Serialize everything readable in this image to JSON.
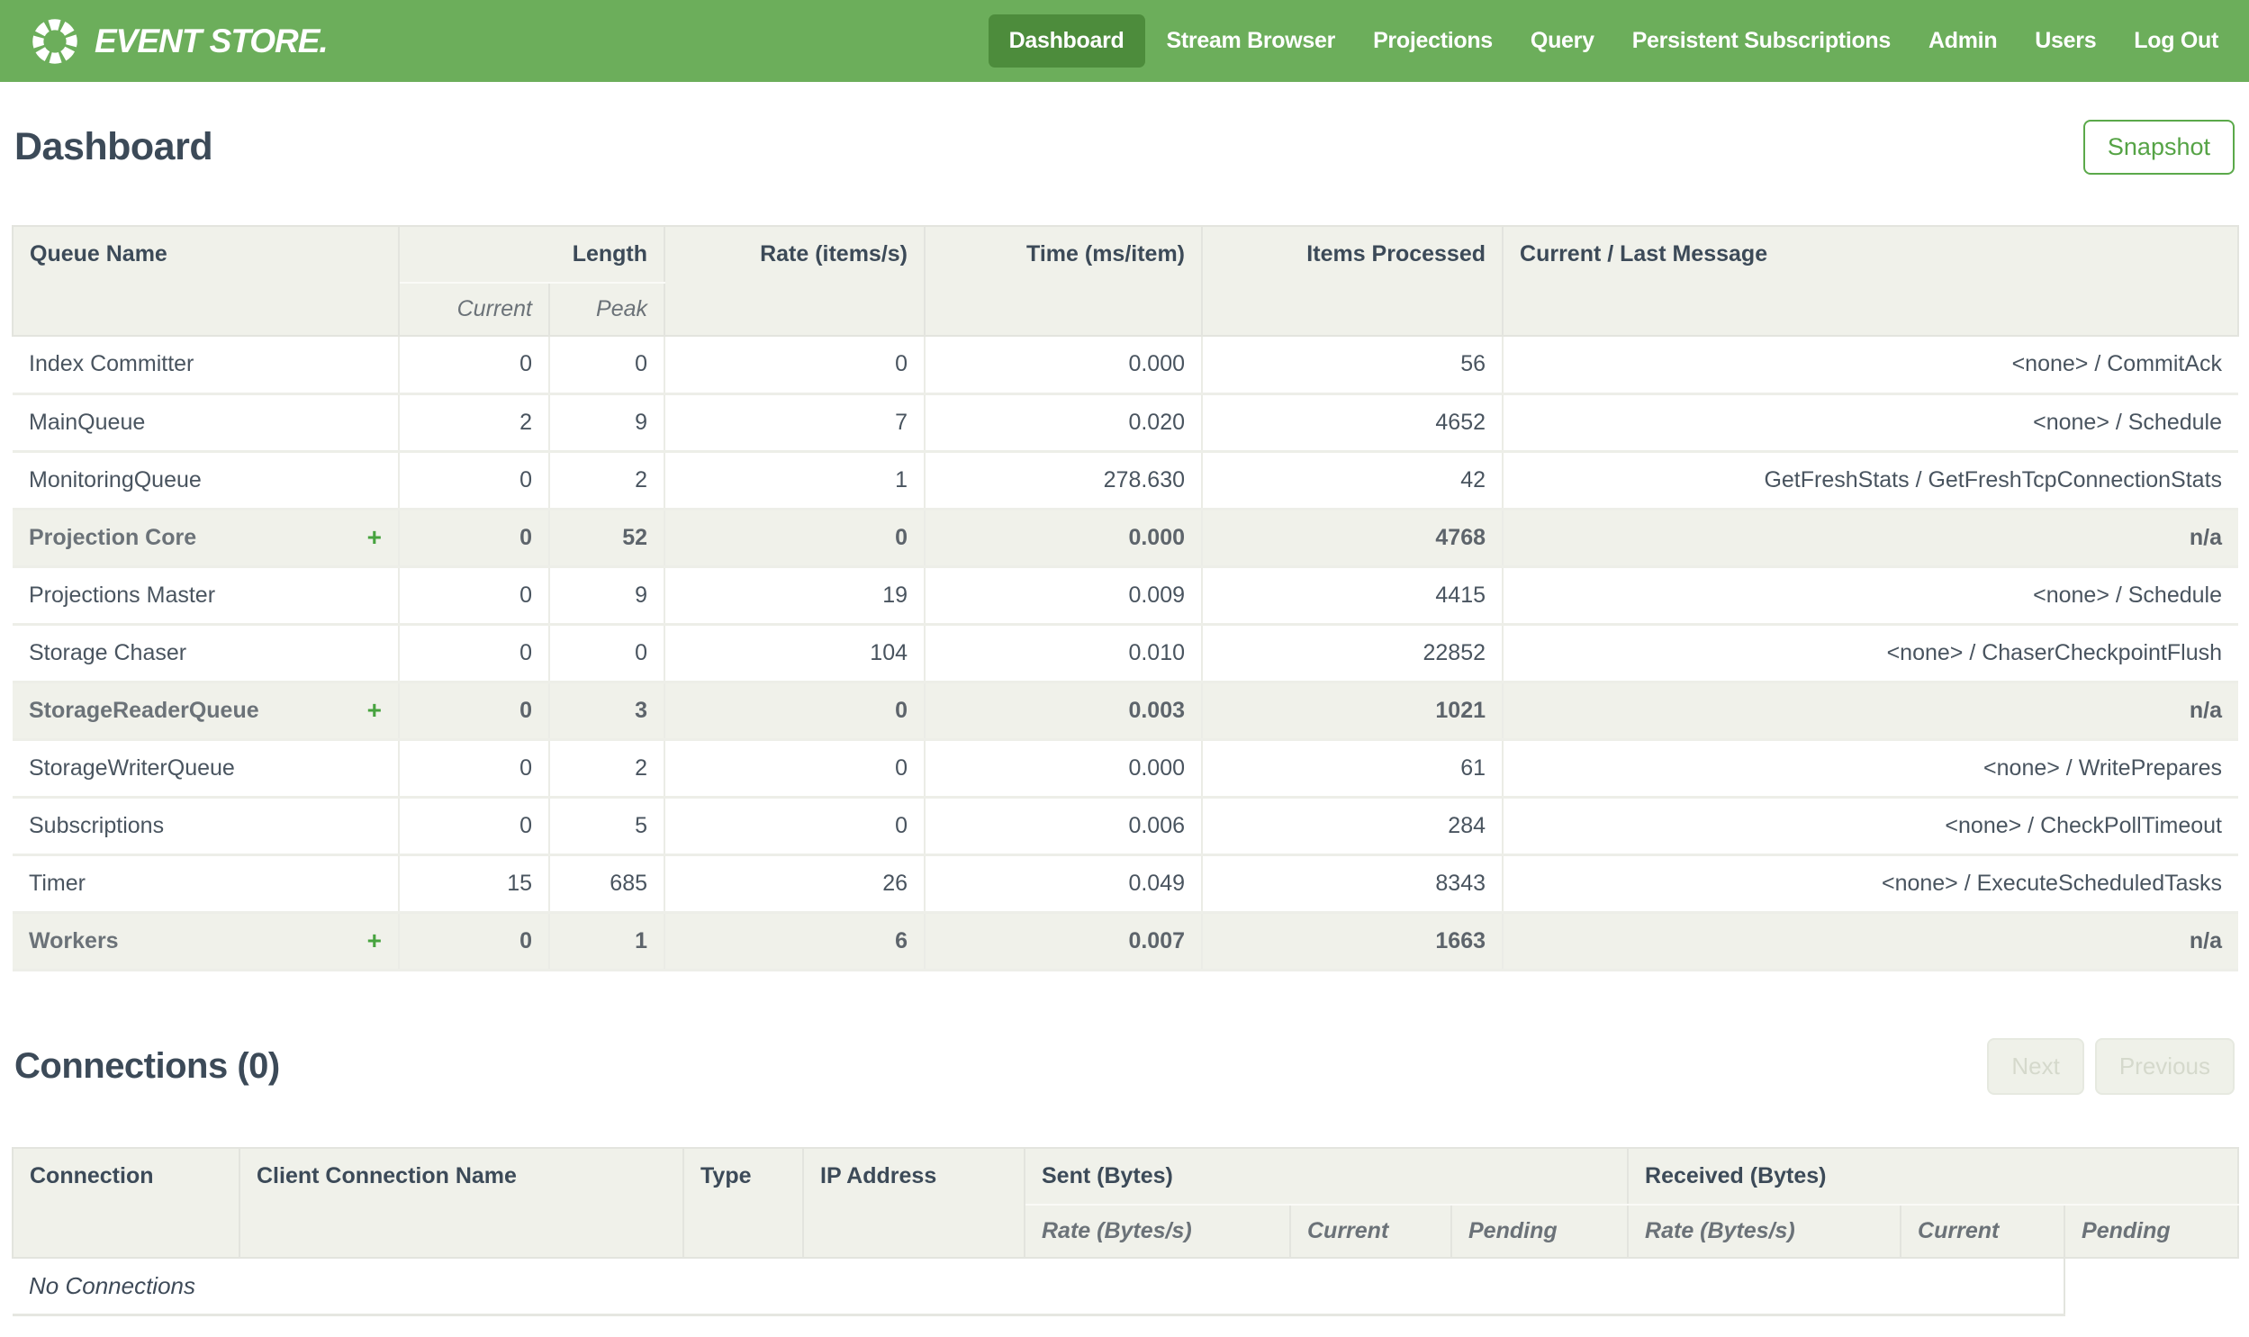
{
  "brand": {
    "logo_text": "EVENT STORE."
  },
  "nav": {
    "items": [
      {
        "label": "Dashboard",
        "active": true
      },
      {
        "label": "Stream Browser",
        "active": false
      },
      {
        "label": "Projections",
        "active": false
      },
      {
        "label": "Query",
        "active": false
      },
      {
        "label": "Persistent Subscriptions",
        "active": false
      },
      {
        "label": "Admin",
        "active": false
      },
      {
        "label": "Users",
        "active": false
      },
      {
        "label": "Log Out",
        "active": false
      }
    ]
  },
  "page": {
    "title": "Dashboard",
    "snapshot_label": "Snapshot"
  },
  "queues_table": {
    "headers": {
      "queue_name": "Queue Name",
      "length": "Length",
      "current": "Current",
      "peak": "Peak",
      "rate": "Rate (items/s)",
      "time": "Time (ms/item)",
      "items_processed": "Items Processed",
      "message": "Current / Last Message"
    },
    "expand_icon": "+",
    "rows": [
      {
        "name": "Index Committer",
        "group": false,
        "current": "0",
        "peak": "0",
        "rate": "0",
        "time": "0.000",
        "items": "56",
        "message": "<none> / CommitAck"
      },
      {
        "name": "MainQueue",
        "group": false,
        "current": "2",
        "peak": "9",
        "rate": "7",
        "time": "0.020",
        "items": "4652",
        "message": "<none> / Schedule"
      },
      {
        "name": "MonitoringQueue",
        "group": false,
        "current": "0",
        "peak": "2",
        "rate": "1",
        "time": "278.630",
        "items": "42",
        "message": "GetFreshStats / GetFreshTcpConnectionStats"
      },
      {
        "name": "Projection Core",
        "group": true,
        "current": "0",
        "peak": "52",
        "rate": "0",
        "time": "0.000",
        "items": "4768",
        "message": "n/a"
      },
      {
        "name": "Projections Master",
        "group": false,
        "current": "0",
        "peak": "9",
        "rate": "19",
        "time": "0.009",
        "items": "4415",
        "message": "<none> / Schedule"
      },
      {
        "name": "Storage Chaser",
        "group": false,
        "current": "0",
        "peak": "0",
        "rate": "104",
        "time": "0.010",
        "items": "22852",
        "message": "<none> / ChaserCheckpointFlush"
      },
      {
        "name": "StorageReaderQueue",
        "group": true,
        "current": "0",
        "peak": "3",
        "rate": "0",
        "time": "0.003",
        "items": "1021",
        "message": "n/a"
      },
      {
        "name": "StorageWriterQueue",
        "group": false,
        "current": "0",
        "peak": "2",
        "rate": "0",
        "time": "0.000",
        "items": "61",
        "message": "<none> / WritePrepares"
      },
      {
        "name": "Subscriptions",
        "group": false,
        "current": "0",
        "peak": "5",
        "rate": "0",
        "time": "0.006",
        "items": "284",
        "message": "<none> / CheckPollTimeout"
      },
      {
        "name": "Timer",
        "group": false,
        "current": "15",
        "peak": "685",
        "rate": "26",
        "time": "0.049",
        "items": "8343",
        "message": "<none> / ExecuteScheduledTasks"
      },
      {
        "name": "Workers",
        "group": true,
        "current": "0",
        "peak": "1",
        "rate": "6",
        "time": "0.007",
        "items": "1663",
        "message": "n/a"
      }
    ]
  },
  "connections": {
    "title": "Connections (0)",
    "next_label": "Next",
    "previous_label": "Previous",
    "headers": {
      "connection": "Connection",
      "client_name": "Client Connection Name",
      "type": "Type",
      "ip": "IP Address",
      "sent": "Sent (Bytes)",
      "received": "Received (Bytes)",
      "rate": "Rate (Bytes/s)",
      "current": "Current",
      "pending": "Pending"
    },
    "empty_text": "No Connections"
  },
  "colors": {
    "brand_green": "#6CAE5B",
    "active_nav_green": "#4D8C3C",
    "snapshot_green": "#55A345",
    "plus_green": "#47A33F",
    "header_cell_bg": "#F0F1EA",
    "text_dark": "#3C4A58",
    "text_body": "#49545F",
    "text_gray": "#6B7278",
    "disabled_text": "#D5D9CC",
    "disabled_bg": "#EFF1E9"
  }
}
